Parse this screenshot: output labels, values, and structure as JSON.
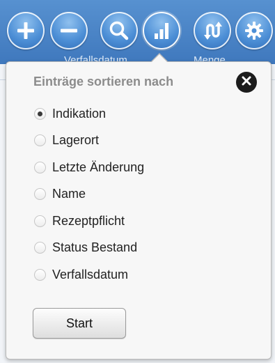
{
  "toolbar": {
    "buttons": [
      {
        "icon": "plus-icon"
      },
      {
        "icon": "minus-icon"
      },
      {
        "icon": "search-icon"
      },
      {
        "icon": "bar-chart-icon",
        "active": true
      },
      {
        "icon": "sync-arrows-icon"
      },
      {
        "icon": "gear-icon"
      }
    ],
    "labels": {
      "left": "Verfallsdatum",
      "right": "Menge"
    },
    "colors": {
      "bar": "#4a86c8",
      "button_fill": "#4d8fd6"
    }
  },
  "popover": {
    "title": "Einträge sortieren nach",
    "close_icon": "close-icon",
    "options": [
      {
        "label": "Indikation",
        "selected": true
      },
      {
        "label": "Lagerort",
        "selected": false
      },
      {
        "label": "Letzte Änderung",
        "selected": false
      },
      {
        "label": "Name",
        "selected": false
      },
      {
        "label": "Rezeptpflicht",
        "selected": false
      },
      {
        "label": "Status Bestand",
        "selected": false
      },
      {
        "label": "Verfallsdatum",
        "selected": false
      }
    ],
    "start_label": "Start"
  }
}
